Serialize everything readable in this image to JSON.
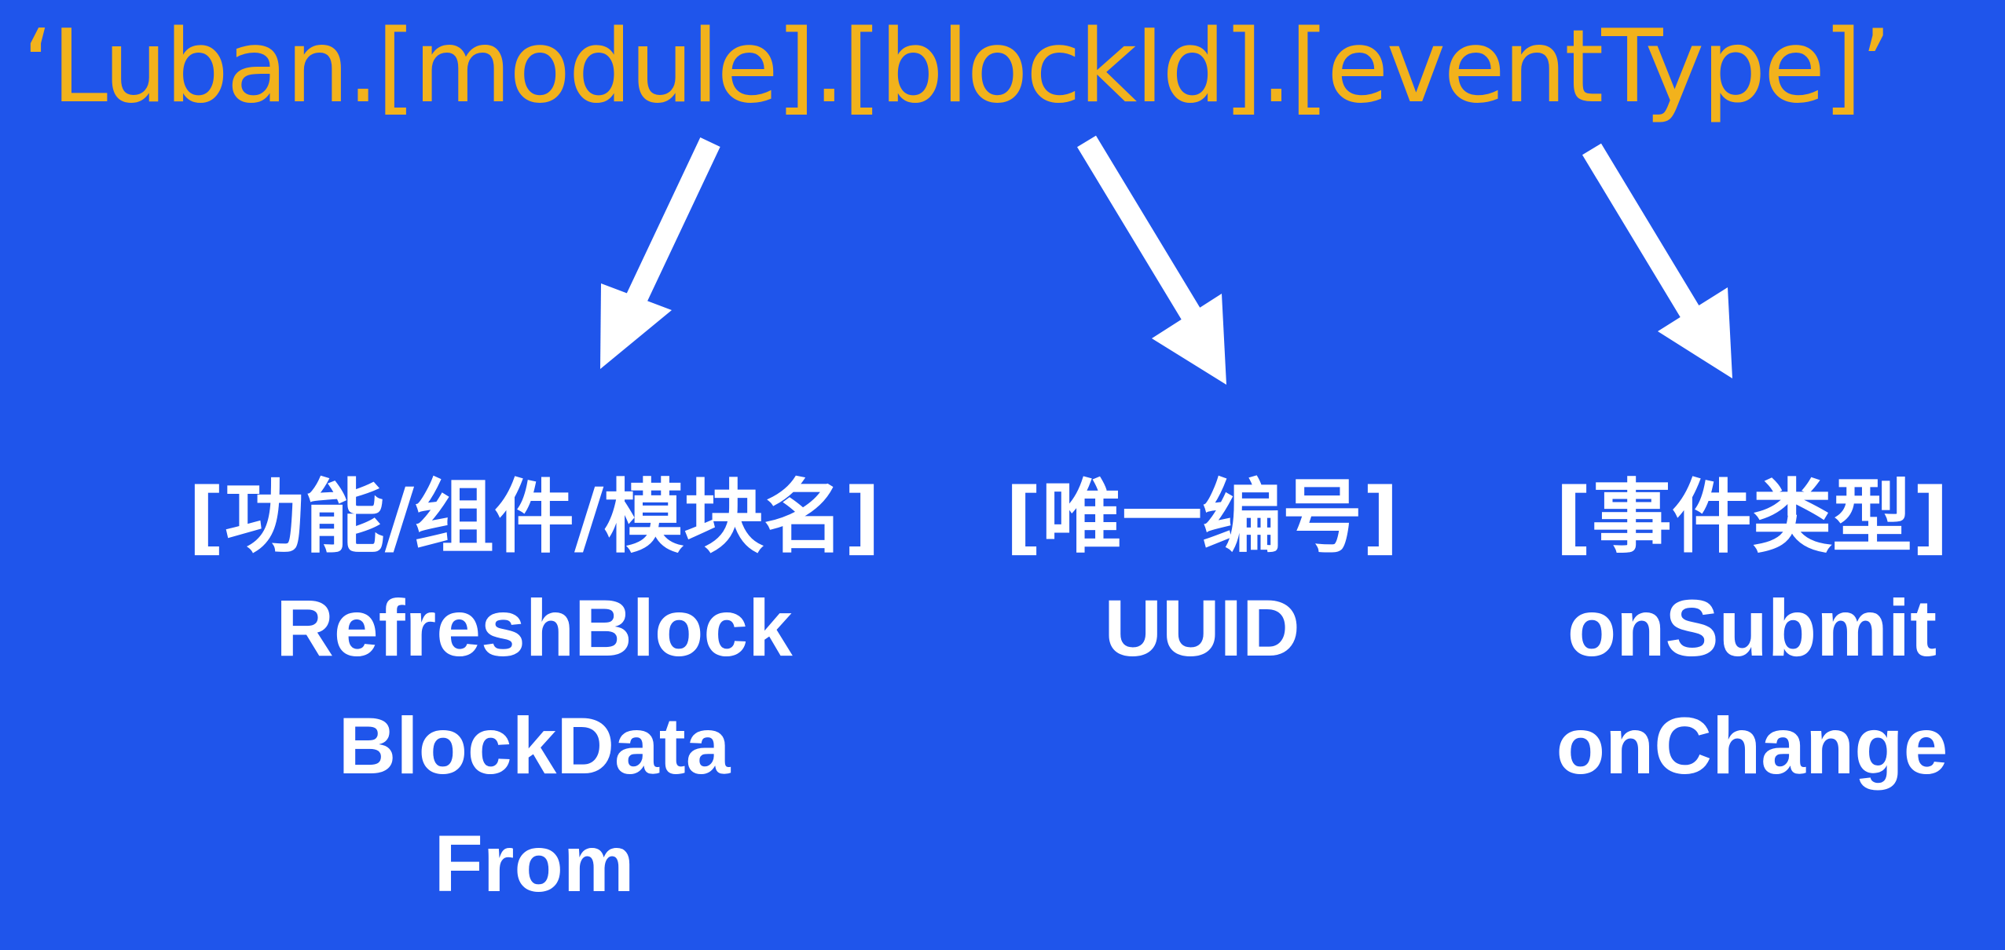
{
  "template": {
    "text": "‘Luban.[module].[blockId].[eventType]’"
  },
  "columns": {
    "module": {
      "title": "[功能/组件/模块名]",
      "values": [
        "RefreshBlock",
        "BlockData",
        "From"
      ]
    },
    "block_id": {
      "title": "[唯一编号]",
      "values": [
        "UUID"
      ]
    },
    "event_type": {
      "title": "[事件类型]",
      "values": [
        "onSubmit",
        "onChange"
      ]
    }
  },
  "colors": {
    "background": "#1f55eb",
    "template_text": "#f2b21c",
    "arrows_and_labels": "#ffffff"
  }
}
